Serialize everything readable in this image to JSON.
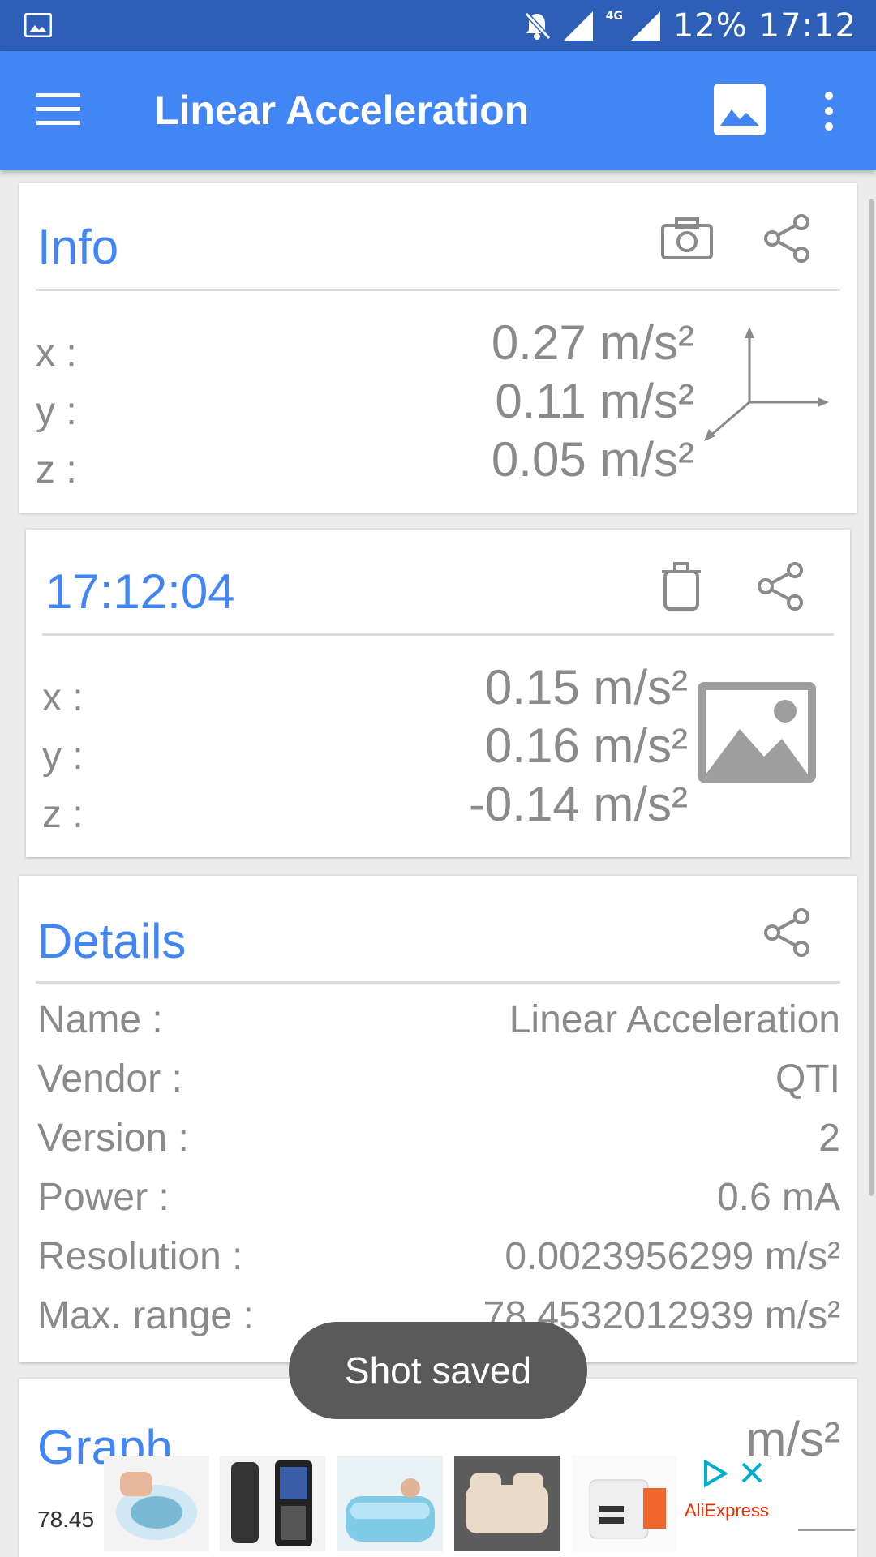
{
  "status_bar": {
    "battery": "12%",
    "time": "17:12",
    "network": "4G"
  },
  "app_bar": {
    "title": "Linear Acceleration"
  },
  "info_card": {
    "title": "Info",
    "rows": [
      {
        "label": "x :",
        "value": "0.27 m/s²"
      },
      {
        "label": "y :",
        "value": "0.11 m/s²"
      },
      {
        "label": "z :",
        "value": "0.05 m/s²"
      }
    ]
  },
  "snapshot_card": {
    "title": "17:12:04",
    "rows": [
      {
        "label": "x :",
        "value": "0.15 m/s²"
      },
      {
        "label": "y :",
        "value": "0.16 m/s²"
      },
      {
        "label": "z :",
        "value": "-0.14 m/s²"
      }
    ]
  },
  "details_card": {
    "title": "Details",
    "rows": [
      {
        "label": "Name :",
        "value": "Linear Acceleration"
      },
      {
        "label": "Vendor :",
        "value": "QTI"
      },
      {
        "label": "Version :",
        "value": "2"
      },
      {
        "label": "Power :",
        "value": "0.6 mA"
      },
      {
        "label": "Resolution :",
        "value": "0.0023956299 m/s²"
      },
      {
        "label": "Max. range :",
        "value": "78.4532012939 m/s²"
      }
    ]
  },
  "graph_card": {
    "title": "Graph",
    "unit": "m/s²",
    "axis_value": "78.45"
  },
  "toast": {
    "message": "Shot saved"
  },
  "ad": {
    "brand": "AliExpress"
  },
  "colors": {
    "status_bar": "#2d5fb7",
    "app_bar": "#4285f4",
    "accent": "#4285f4",
    "text": "#8a8a8a"
  },
  "icons": [
    "image-icon",
    "menu-icon",
    "overflow-icon",
    "camera-icon",
    "share-icon",
    "axes-icon",
    "trash-icon",
    "picture-icon",
    "bell-muted-icon",
    "signal-icon"
  ]
}
